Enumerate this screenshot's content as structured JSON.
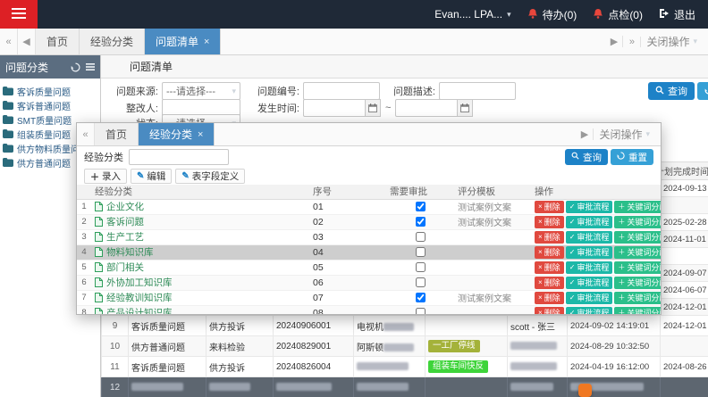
{
  "theme": {
    "topbar_bg": "#1f2937",
    "logo_red": "#dd2025",
    "active_tab_blue": "#4a8bc2",
    "search_button_blue": "#1d82c7",
    "reset_button_blue": "#35a0d6",
    "delete_button_red": "#e0493f",
    "approve_button_teal": "#1cb8a8",
    "keyword_button_green": "#2bbf8a",
    "badge_olive": "#a4b23a",
    "badge_green": "#3ed43a",
    "bell_red": "#e8463c"
  },
  "topbar": {
    "user_label": "Evan.... LPA...",
    "todo_label": "待办(0)",
    "inspect_label": "点检(0)",
    "logout_label": "退出"
  },
  "main_tabbar": {
    "tabs": [
      {
        "key": "home",
        "label": "首页",
        "active": false,
        "closable": false
      },
      {
        "key": "experience-category",
        "label": "经验分类",
        "active": false,
        "closable": false
      },
      {
        "key": "issue-list",
        "label": "问题清单",
        "active": true,
        "closable": true
      }
    ],
    "close_ops_label": "关闭操作"
  },
  "sidebar": {
    "title": "问题分类",
    "items": [
      "客诉质量问题",
      "客诉普通问题",
      "SMT质量问题",
      "组装质量问题",
      "供方物料质量问题",
      "供方普通问题"
    ]
  },
  "main": {
    "title": "问题清单",
    "form": {
      "source_label": "问题来源:",
      "source_value": "---请选择---",
      "number_label": "问题编号:",
      "number_value": "",
      "desc_label": "问题描述:",
      "desc_value": "",
      "person_label": "整改人:",
      "person_value": "",
      "time_label": "发生时间:",
      "time_from": "",
      "time_separator": "~",
      "time_to": "",
      "status_label": "状态:",
      "status_value": "---请选择---",
      "search_label": "查询",
      "reset_label": "重置"
    },
    "table": {
      "plan_header": "计划完成时间",
      "rows": [
        {
          "num": "1",
          "plan": "2024-09-13"
        },
        {
          "num": "2",
          "plan": ""
        },
        {
          "num": "3",
          "plan": "2025-02-28"
        },
        {
          "num": "4",
          "plan": "2024-11-01"
        },
        {
          "num": "5",
          "plan": ""
        },
        {
          "num": "6",
          "plan": "2024-09-07"
        },
        {
          "num": "7",
          "plan": "2024-06-07"
        },
        {
          "num": "8",
          "plan": "2024-12-01"
        },
        {
          "num": "9",
          "category": "客诉质量问题",
          "source": "供方投诉",
          "code": "20240906001",
          "desc": "电视机",
          "desc_redacted": true,
          "badge": "",
          "person": "scott - 张三",
          "time": "2024-09-02 14:19:01",
          "plan": "2024-12-01"
        },
        {
          "num": "10",
          "category": "供方普通问题",
          "source": "来料检验",
          "code": "20240829001",
          "desc": "阿斯顿",
          "desc_redacted": true,
          "badge": "一工厂停线",
          "badge_color": "#a4b23a",
          "person": "",
          "person_redacted": true,
          "time": "2024-08-29 10:32:50",
          "plan": ""
        },
        {
          "num": "11",
          "category": "客诉质量问题",
          "source": "供方投诉",
          "code": "20240826004",
          "desc": "",
          "desc_redacted": true,
          "badge": "组装车间快反",
          "badge_color": "#3ed43a",
          "person": "",
          "person_redacted": true,
          "time": "2024-04-19 16:12:00",
          "plan": "2024-08-26"
        },
        {
          "num": "12",
          "category": "",
          "source": "",
          "code": "",
          "desc": "",
          "badge": "",
          "person": "",
          "time": "",
          "plan": "",
          "selected": true,
          "row_redacted": true
        }
      ]
    }
  },
  "popup": {
    "tabbar": {
      "tabs": [
        {
          "key": "home",
          "label": "首页",
          "active": false,
          "closable": false
        },
        {
          "key": "experience-category",
          "label": "经验分类",
          "active": true,
          "closable": true
        }
      ],
      "close_ops_label": "关闭操作"
    },
    "search": {
      "label": "经验分类",
      "value": "",
      "search_label": "查询",
      "reset_label": "重置"
    },
    "toolbar": {
      "add_label": "录入",
      "edit_label": "编辑",
      "define_label": "表字段定义"
    },
    "table": {
      "headers": [
        "经验分类",
        "序号",
        "需要审批",
        "评分模板",
        "操作"
      ],
      "actions": {
        "delete": "删除",
        "approve": "审批流程",
        "keyword": "关键词分配"
      },
      "rows": [
        {
          "num": "1",
          "name": "企业文化",
          "order": "01",
          "approve": true,
          "template": "测试案例文案"
        },
        {
          "num": "2",
          "name": "客诉问题",
          "order": "02",
          "approve": true,
          "template": "测试案例文案"
        },
        {
          "num": "3",
          "name": "生产工艺",
          "order": "03",
          "approve": false,
          "template": ""
        },
        {
          "num": "4",
          "name": "物料知识库",
          "order": "04",
          "approve": false,
          "template": "",
          "selected": true
        },
        {
          "num": "5",
          "name": "部门相关",
          "order": "05",
          "approve": false,
          "template": ""
        },
        {
          "num": "6",
          "name": "外协加工知识库",
          "order": "06",
          "approve": false,
          "template": ""
        },
        {
          "num": "7",
          "name": "经验教训知识库",
          "order": "07",
          "approve": true,
          "template": "测试案例文案"
        },
        {
          "num": "8",
          "name": "产品设计知识库",
          "order": "08",
          "approve": false,
          "template": ""
        }
      ]
    }
  }
}
